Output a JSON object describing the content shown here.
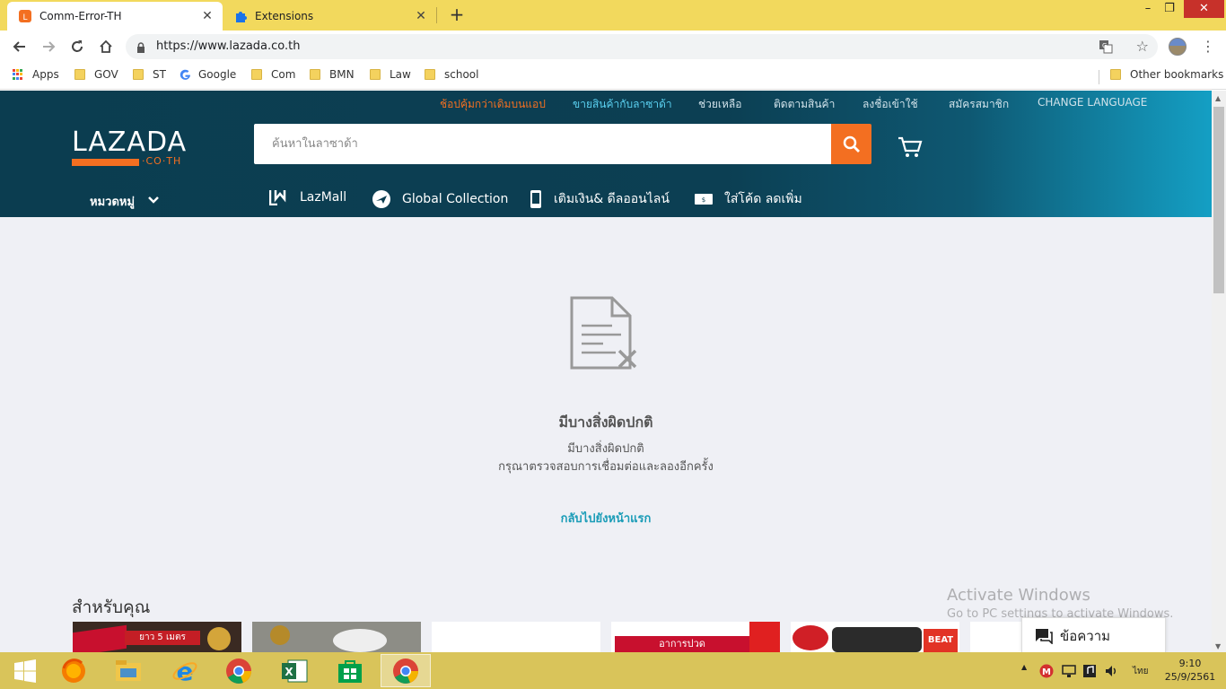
{
  "browser": {
    "tabs": [
      {
        "title": "Comm-Error-TH",
        "close": "✕"
      },
      {
        "title": "Extensions",
        "close": "✕"
      }
    ],
    "new_tab": "+",
    "window_controls": {
      "minimize": "–",
      "maximize": "❐",
      "close": "✕"
    },
    "url": "https://www.lazada.co.th",
    "bookmarks": [
      {
        "label": "Apps",
        "icon": "apps-grid-icon"
      },
      {
        "label": "GOV",
        "icon": "folder-icon"
      },
      {
        "label": "ST",
        "icon": "folder-icon"
      },
      {
        "label": "Google",
        "icon": "google-icon"
      },
      {
        "label": "Com",
        "icon": "folder-icon"
      },
      {
        "label": "BMN",
        "icon": "folder-icon"
      },
      {
        "label": "Law",
        "icon": "folder-icon"
      },
      {
        "label": "school",
        "icon": "folder-icon"
      }
    ],
    "other_bookmarks": "Other bookmarks"
  },
  "lazada": {
    "top_nav": [
      {
        "label": "ช้อปคุ้มกว่าเดิมบนแอป",
        "color": "#f36f21"
      },
      {
        "label": "ขายสินค้ากับลาซาด้า",
        "color": "#5ad0f0"
      },
      {
        "label": "ช่วยเหลือ",
        "color": "#d0e2ea"
      },
      {
        "label": "ติดตามสินค้า",
        "color": "#d0e2ea"
      },
      {
        "label": "ลงชื่อเข้าใช้",
        "color": "#d0e2ea"
      },
      {
        "label": "สมัครสมาชิก",
        "color": "#d0e2ea"
      },
      {
        "label": "CHANGE LANGUAGE",
        "color": "#d0e2ea"
      }
    ],
    "logo": {
      "word": "LAZADA",
      "suffix": "·CO·TH"
    },
    "search_placeholder": "ค้นหาในลาซาด้า",
    "category_label": "หมวดหมู่",
    "sub_nav": [
      {
        "label": "LazMall",
        "icon": "lazmall-icon"
      },
      {
        "label": "Global Collection",
        "icon": "plane-icon"
      },
      {
        "label": "เติมเงิน& ดีลออนไลน์",
        "icon": "phone-icon"
      },
      {
        "label": "ใส่โค้ด ลดเพิ่ม",
        "icon": "voucher-icon"
      }
    ],
    "accent": "#f36f21",
    "header_bg": "#0b3d50"
  },
  "error": {
    "title": "มีบางสิ่งผิดปกติ",
    "line1": "มีบางสิ่งผิดปกติ",
    "line2": "กรุณาตรวจสอบการเชื่อมต่อและลองอีกครั้ง",
    "link": "กลับไปยังหน้าแรก"
  },
  "for_you": {
    "heading": "สำหรับคุณ",
    "cards": [
      {
        "text": "ยาว 5 เมตร"
      },
      {
        "text": ""
      },
      {
        "text": ""
      },
      {
        "text": "อาการปวด"
      },
      {
        "text": "BEAT"
      },
      {
        "text": ""
      }
    ]
  },
  "chat": {
    "label": "ข้อความ"
  },
  "watermark": {
    "line1": "Activate Windows",
    "line2": "Go to PC settings to activate Windows."
  },
  "taskbar": {
    "items": [
      "windows-start-icon",
      "firefox-icon",
      "file-explorer-icon",
      "internet-explorer-icon",
      "chrome-icon",
      "excel-icon",
      "store-icon",
      "chrome-active-icon"
    ],
    "lang": "ไทย",
    "time": "9:10",
    "date": "25/9/2561"
  }
}
